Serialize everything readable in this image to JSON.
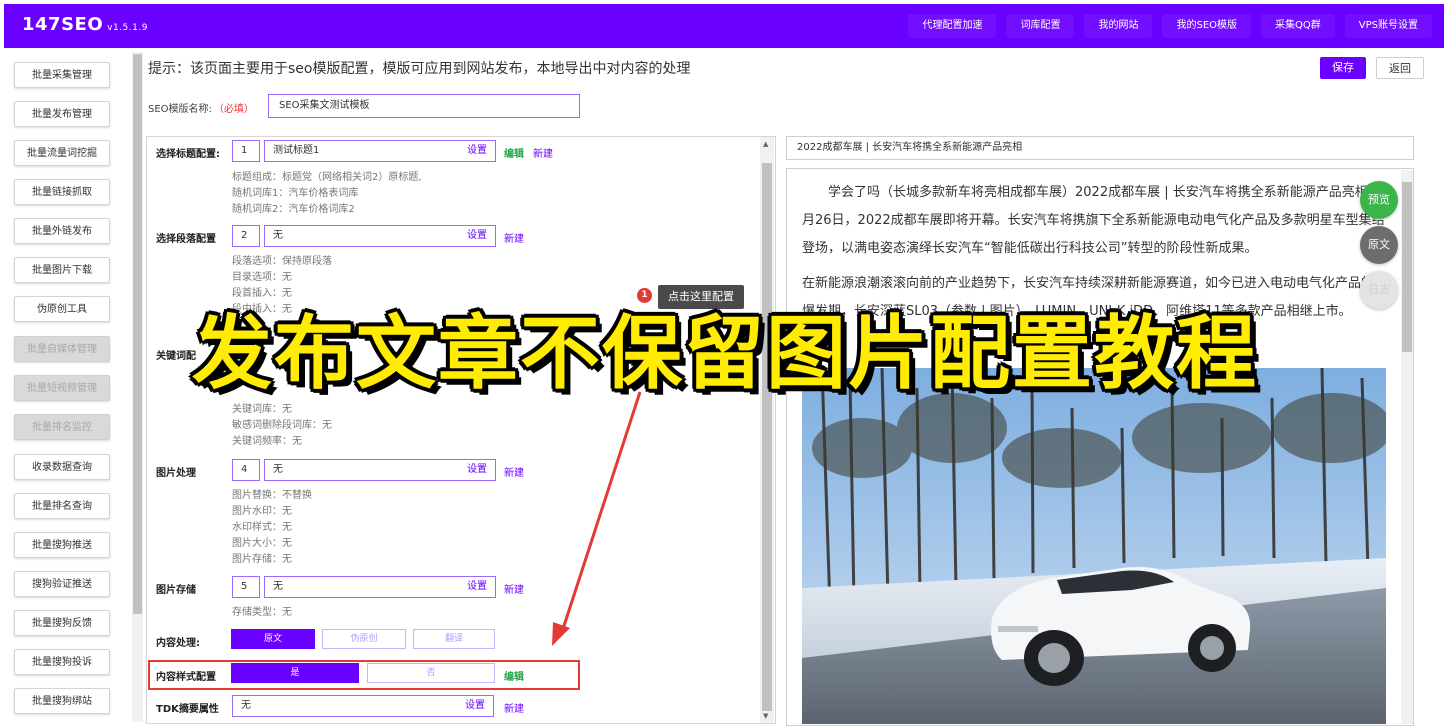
{
  "app": {
    "brand": "147SEO",
    "version": "v1.5.1.9"
  },
  "topnav": [
    "代理配置加速",
    "词库配置",
    "我的网站",
    "我的SEO模版",
    "采集QQ群",
    "VPS账号设置"
  ],
  "sidebar": [
    {
      "label": "批量采集管理",
      "disabled": false
    },
    {
      "label": "批量发布管理",
      "disabled": false
    },
    {
      "label": "批量流量词挖掘",
      "disabled": false
    },
    {
      "label": "批量链接抓取",
      "disabled": false
    },
    {
      "label": "批量外链发布",
      "disabled": false
    },
    {
      "label": "批量图片下载",
      "disabled": false
    },
    {
      "label": "伪原创工具",
      "disabled": false
    },
    {
      "label": "批量自媒体管理",
      "disabled": true
    },
    {
      "label": "批量短视频管理",
      "disabled": true
    },
    {
      "label": "批量排名监控",
      "disabled": true
    },
    {
      "label": "收录数据查询",
      "disabled": false
    },
    {
      "label": "批量排名查询",
      "disabled": false
    },
    {
      "label": "批量搜狗推送",
      "disabled": false
    },
    {
      "label": "搜狗验证推送",
      "disabled": false
    },
    {
      "label": "批量搜狗反馈",
      "disabled": false
    },
    {
      "label": "批量搜狗投诉",
      "disabled": false
    },
    {
      "label": "批量搜狗绑站",
      "disabled": false
    }
  ],
  "header": {
    "hint": "提示：该页面主要用于seo模版配置，模版可应用到网站发布，本地导出中对内容的处理",
    "save_label": "保存",
    "back_label": "返回",
    "template_label": "SEO模版名称:",
    "required_label": "（必填）",
    "template_value": "SEO采集文测试模板"
  },
  "config": {
    "title": {
      "label": "选择标题配置:",
      "num": "1",
      "value": "测试标题1",
      "set": "设置",
      "edit": "编辑",
      "new": "新建",
      "details": [
        "标题组成：标题党（网络相关词2）原标题,",
        "随机词库1：汽车价格表词库",
        "随机词库2：汽车价格词库2"
      ]
    },
    "paragraph": {
      "label": "选择段落配置",
      "num": "2",
      "value": "无",
      "set": "设置",
      "new": "新建",
      "details": [
        "段落选项：保持原段落",
        "目录选项：无",
        "段首插入：无",
        "段中插入：无"
      ]
    },
    "keyword": {
      "label": "关键词配",
      "details": [
        "关键词库：无",
        "敏感词删除段词库：无",
        "关键词频率：无"
      ]
    },
    "image_proc": {
      "label": "图片处理",
      "num": "4",
      "value": "无",
      "set": "设置",
      "new": "新建",
      "details": [
        "图片替换：不替换",
        "图片水印：无",
        "水印样式：无",
        "图片大小：无",
        "图片存储：无"
      ]
    },
    "image_store": {
      "label": "图片存储",
      "num": "5",
      "value": "无",
      "set": "设置",
      "new": "新建",
      "details": [
        "存储类型：无"
      ]
    },
    "content_proc": {
      "label": "内容处理:",
      "options": [
        "原文",
        "伪原创",
        "翻译"
      ]
    },
    "content_style": {
      "label": "内容样式配置",
      "yes": "是",
      "no": "否",
      "edit": "编辑"
    },
    "tdk": {
      "label": "TDK摘要属性",
      "value": "无",
      "set": "设置",
      "new": "新建"
    }
  },
  "tooltip": {
    "badge": "1",
    "text": "点击这里配置"
  },
  "preview": {
    "title": "2022成都车展 | 长安汽车将携全系新能源产品亮相",
    "para1": "学会了吗（长城多款新车将亮相成都车展）2022成都车展 | 长安汽车将携全系新能源产品亮相, 8月26日，2022成都车展即将开幕。长安汽车将携旗下全系新能源电动电气化产品及多款明星车型集结登场，以满电姿态演绎长安汽车“智能低碳出行科技公司”转型的阶段性新成果。",
    "para2": "在新能源浪潮滚滚向前的产业趋势下，长安汽车持续深耕新能源赛道，如今已进入电动电气化产品的爆发期，长安深蓝SL03（参数 | 图片），LUMIN、UNI-K iDD、阿维塔11等多款产品相继上市。",
    "btn_preview": "预览",
    "btn_original": "原文",
    "btn_log": "日志"
  },
  "overlay": {
    "title": "发布文章不保留图片配置教程"
  },
  "colors": {
    "brand": "#6a00ff",
    "edit": "#2aa54a",
    "highlight": "#e53935",
    "overlay": "#ffec00"
  }
}
